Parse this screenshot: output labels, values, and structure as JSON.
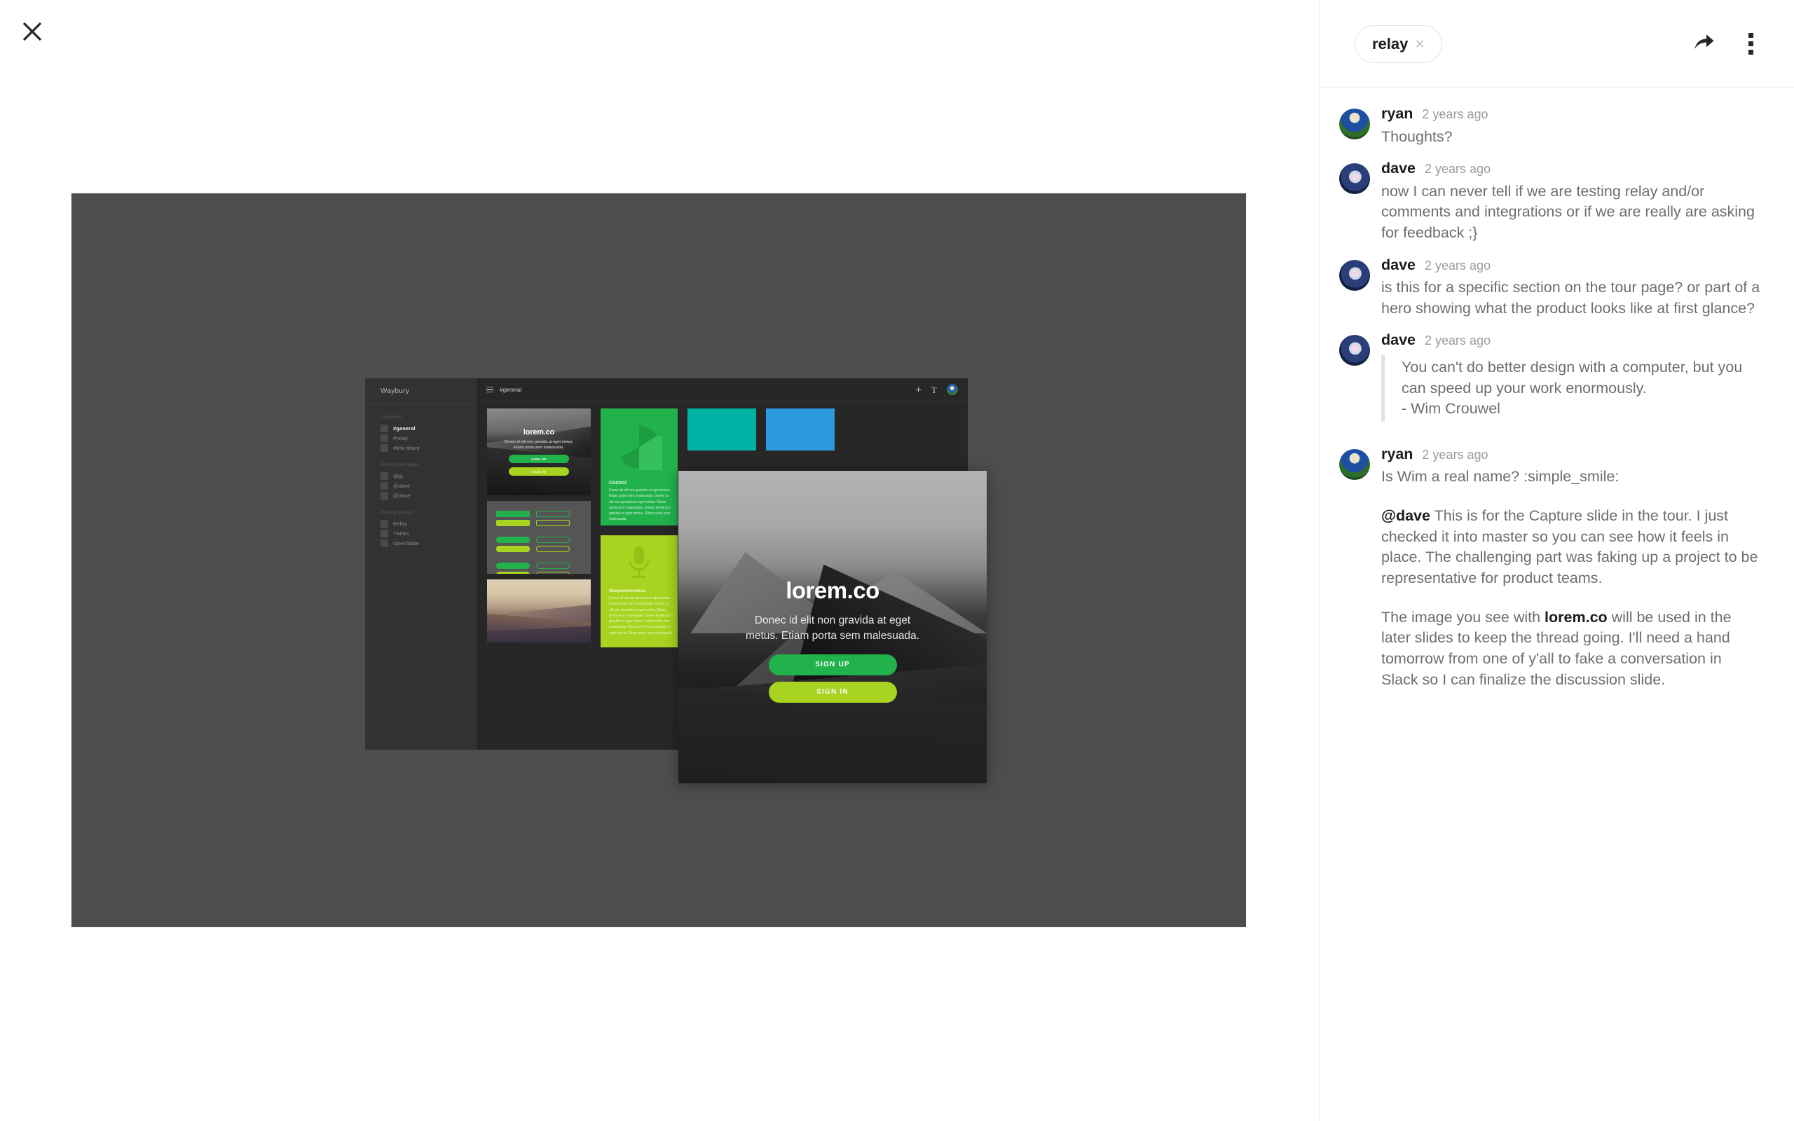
{
  "viewer": {
    "close_label": "close-viewer",
    "close_icon": "close-icon"
  },
  "panel": {
    "tag": {
      "label": "relay",
      "remove_icon": "×"
    },
    "actions": [
      {
        "name": "share-button",
        "icon": "share-arrow-icon"
      },
      {
        "name": "more-options-button",
        "icon": "kebab-menu-icon"
      }
    ]
  },
  "comments": [
    {
      "author": "ryan",
      "avatar": "ryan",
      "timestamp": "2 years ago",
      "paragraphs": [
        "Thoughts?"
      ]
    },
    {
      "author": "dave",
      "avatar": "dave",
      "timestamp": "2 years ago",
      "paragraphs": [
        "now I can never tell if we are testing relay and/or comments and integrations or if we are really are asking for feedback ;}"
      ]
    },
    {
      "author": "dave",
      "avatar": "dave",
      "timestamp": "2 years ago",
      "paragraphs": [
        "is this for a specific section on the tour page? or part of a hero showing what the product looks like at first glance?"
      ]
    },
    {
      "author": "dave",
      "avatar": "dave",
      "timestamp": "2 years ago",
      "quote": "You can't do better design with a computer, but you can speed up your work enormously.\n- Wim Crouwel"
    },
    {
      "author": "ryan",
      "avatar": "ryan",
      "timestamp": "2 years ago",
      "paragraphs": [
        "Is Wim a real name? :simple_smile:"
      ],
      "rich": [
        {
          "bold": "@dave",
          "text": " This is for the Capture slide in the tour. I just checked it into master so you can see how it feels in place.  The challenging part was faking up a project to be representative for product teams."
        },
        {
          "text_before": "The image you see with ",
          "bold": "lorem.co",
          "text": " will be used in the later slides to keep the thread going. I'll need a hand tomorrow from one of y'all to fake a conversation in Slack so I can finalize the discussion slide."
        }
      ]
    }
  ],
  "artwork": {
    "canvas_bg": "#4d4d4d",
    "app": {
      "brand": "Waybury",
      "channel_title": "#general",
      "topbar_icons": [
        "list-icon",
        "plus-icon",
        "text-tool-icon",
        "user-avatar"
      ],
      "groups": [
        {
          "title": "Channels",
          "items": [
            "#general",
            "#relay",
            "#link-share"
          ],
          "active": 0
        },
        {
          "title": "Direct messages",
          "items": [
            "@pj",
            "@dave",
            "@dave"
          ],
          "active": -1
        },
        {
          "title": "Private groups",
          "items": [
            "Relay",
            "Twitter",
            "OpenTable"
          ],
          "active": -1
        }
      ],
      "cards": {
        "control": {
          "heading": "Control",
          "body": "Donec id elit non gravida at eget metus. Etiam porta sem malesuada. Donec id elit non gravida at eget metus. Etiam porta sem malesuada. Donec id elit non gravida at eget metus. Etiam porta sem malesuada.",
          "color": "#22b24c"
        },
        "responsiveness": {
          "heading": "Responsiveness",
          "body": "Donec id elit non gravida at eget metus. Etiam porta sem malesuada. Donec id elit non gravida at eget metus. Etiam porta sem malesuada. Donec id elit non gravida at eget metus. Etiam porta sem malesuada. Donec id elit non gravida at eget metus. Etiam porta sem malesuada.",
          "color": "#a8d320"
        },
        "teal": {
          "color": "#00b3a4"
        },
        "blue": {
          "color": "#2b9ade"
        }
      },
      "hero": {
        "title": "lorem.co",
        "subtitle": "Donec id elit non gravida at eget metus. Etiam porta sem malesuada.",
        "primary_btn": "SIGN UP",
        "secondary_btn": "SIGN IN"
      }
    },
    "modal": {
      "title": "lorem.co",
      "subtitle": "Donec id elit non gravida at eget metus. Etiam porta sem malesuada.",
      "primary_btn": "SIGN UP",
      "secondary_btn": "SIGN IN",
      "primary_color": "#22b24c",
      "secondary_color": "#a8d320"
    }
  }
}
